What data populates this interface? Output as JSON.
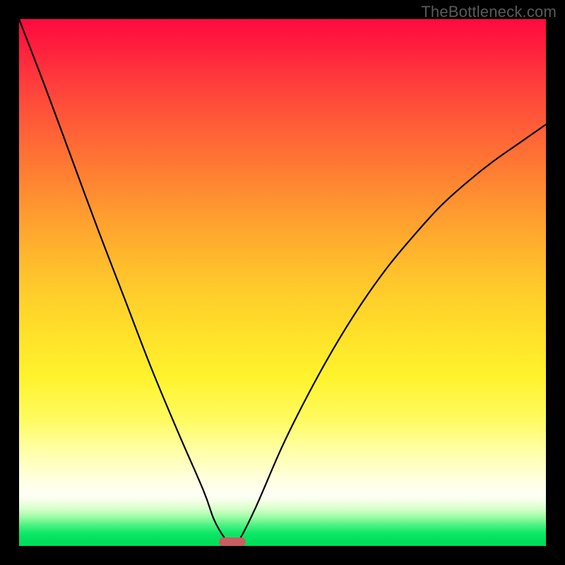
{
  "watermark": "TheBottleneck.com",
  "chart_data": {
    "type": "line",
    "title": "",
    "xlabel": "",
    "ylabel": "",
    "xlim": [
      0,
      100
    ],
    "ylim": [
      0,
      100
    ],
    "x": [
      0,
      5,
      10,
      15,
      20,
      25,
      30,
      35,
      37,
      39,
      40.5,
      42,
      45,
      50,
      55,
      60,
      65,
      70,
      75,
      80,
      85,
      90,
      95,
      100
    ],
    "values": [
      100,
      87,
      73.5,
      60,
      47,
      34,
      22,
      10.5,
      5,
      1.5,
      0,
      1.5,
      7.5,
      19,
      29,
      38,
      46,
      53,
      59,
      64.5,
      69,
      73,
      76.5,
      80
    ],
    "annotations": [
      {
        "label": "marker",
        "x": 40.5,
        "y": 0
      }
    ],
    "background_gradient": {
      "orientation": "vertical",
      "stops": [
        {
          "pos": 0.0,
          "color": "#ff0a3f"
        },
        {
          "pos": 0.3,
          "color": "#ff8a31"
        },
        {
          "pos": 0.6,
          "color": "#ffe12a"
        },
        {
          "pos": 0.86,
          "color": "#ffffd8"
        },
        {
          "pos": 0.93,
          "color": "#d6ffc8"
        },
        {
          "pos": 1.0,
          "color": "#00dd58"
        }
      ]
    }
  },
  "marker": {
    "x_percent": 40.5,
    "color": "#cb5d62"
  }
}
